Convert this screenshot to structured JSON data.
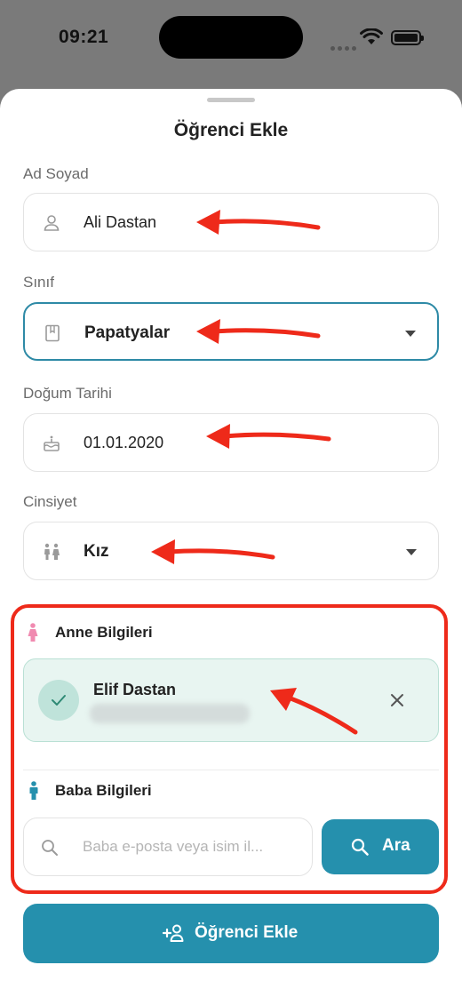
{
  "status": {
    "time": "09:21"
  },
  "sheet": {
    "title": "Öğrenci Ekle"
  },
  "form": {
    "name": {
      "label": "Ad Soyad",
      "value": "Ali Dastan",
      "icon": "person-icon"
    },
    "class": {
      "label": "Sınıf",
      "value": "Papatyalar",
      "icon": "book-icon"
    },
    "birth": {
      "label": "Doğum Tarihi",
      "value": "01.01.2020",
      "icon": "cake-icon"
    },
    "gender": {
      "label": "Cinsiyet",
      "value": "Kız",
      "icon": "people-icon"
    }
  },
  "mother": {
    "title": "Anne Bilgileri",
    "selected_name": "Elif Dastan"
  },
  "father": {
    "title": "Baba Bilgileri",
    "search_placeholder": "Baba e-posta veya isim il...",
    "search_button": "Ara"
  },
  "submit_label": "Öğrenci Ekle",
  "colors": {
    "accent": "#2590ad",
    "highlight": "#ee2a1a",
    "selected_bg": "#e8f5f1"
  }
}
